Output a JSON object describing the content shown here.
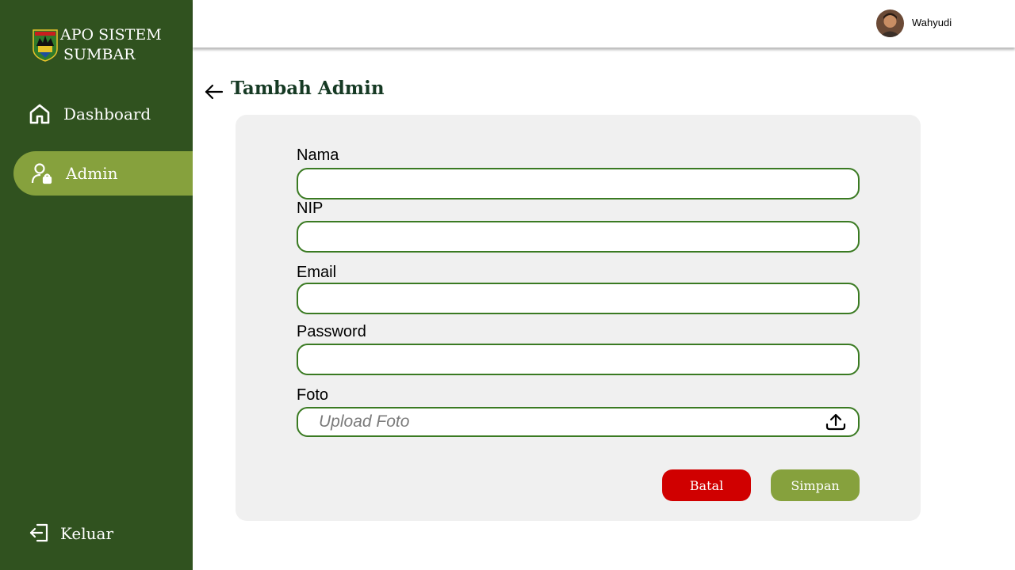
{
  "sidebar": {
    "brand_line1": "APO SISTEM",
    "brand_line2": "SUMBAR",
    "items": [
      {
        "label": "Dashboard",
        "icon": "home-icon"
      },
      {
        "label": "Admin",
        "icon": "admin-user-lock-icon"
      }
    ],
    "logout_label": "Keluar",
    "background": "#30521f",
    "active_color": "#86a13d"
  },
  "header": {
    "username": "Wahyudi"
  },
  "page": {
    "title": "Tambah Admin"
  },
  "form": {
    "fields": [
      {
        "label": "Nama",
        "value": ""
      },
      {
        "label": "NIP",
        "value": ""
      },
      {
        "label": "Email",
        "value": ""
      },
      {
        "label": "Password",
        "value": ""
      }
    ],
    "photo_label": "Foto",
    "photo_placeholder": "Upload Foto",
    "field_border_color": "#3a7a22"
  },
  "buttons": {
    "cancel_label": "Batal",
    "save_label": "Simpan",
    "cancel_color": "#d00000",
    "save_color": "#86a13d"
  }
}
